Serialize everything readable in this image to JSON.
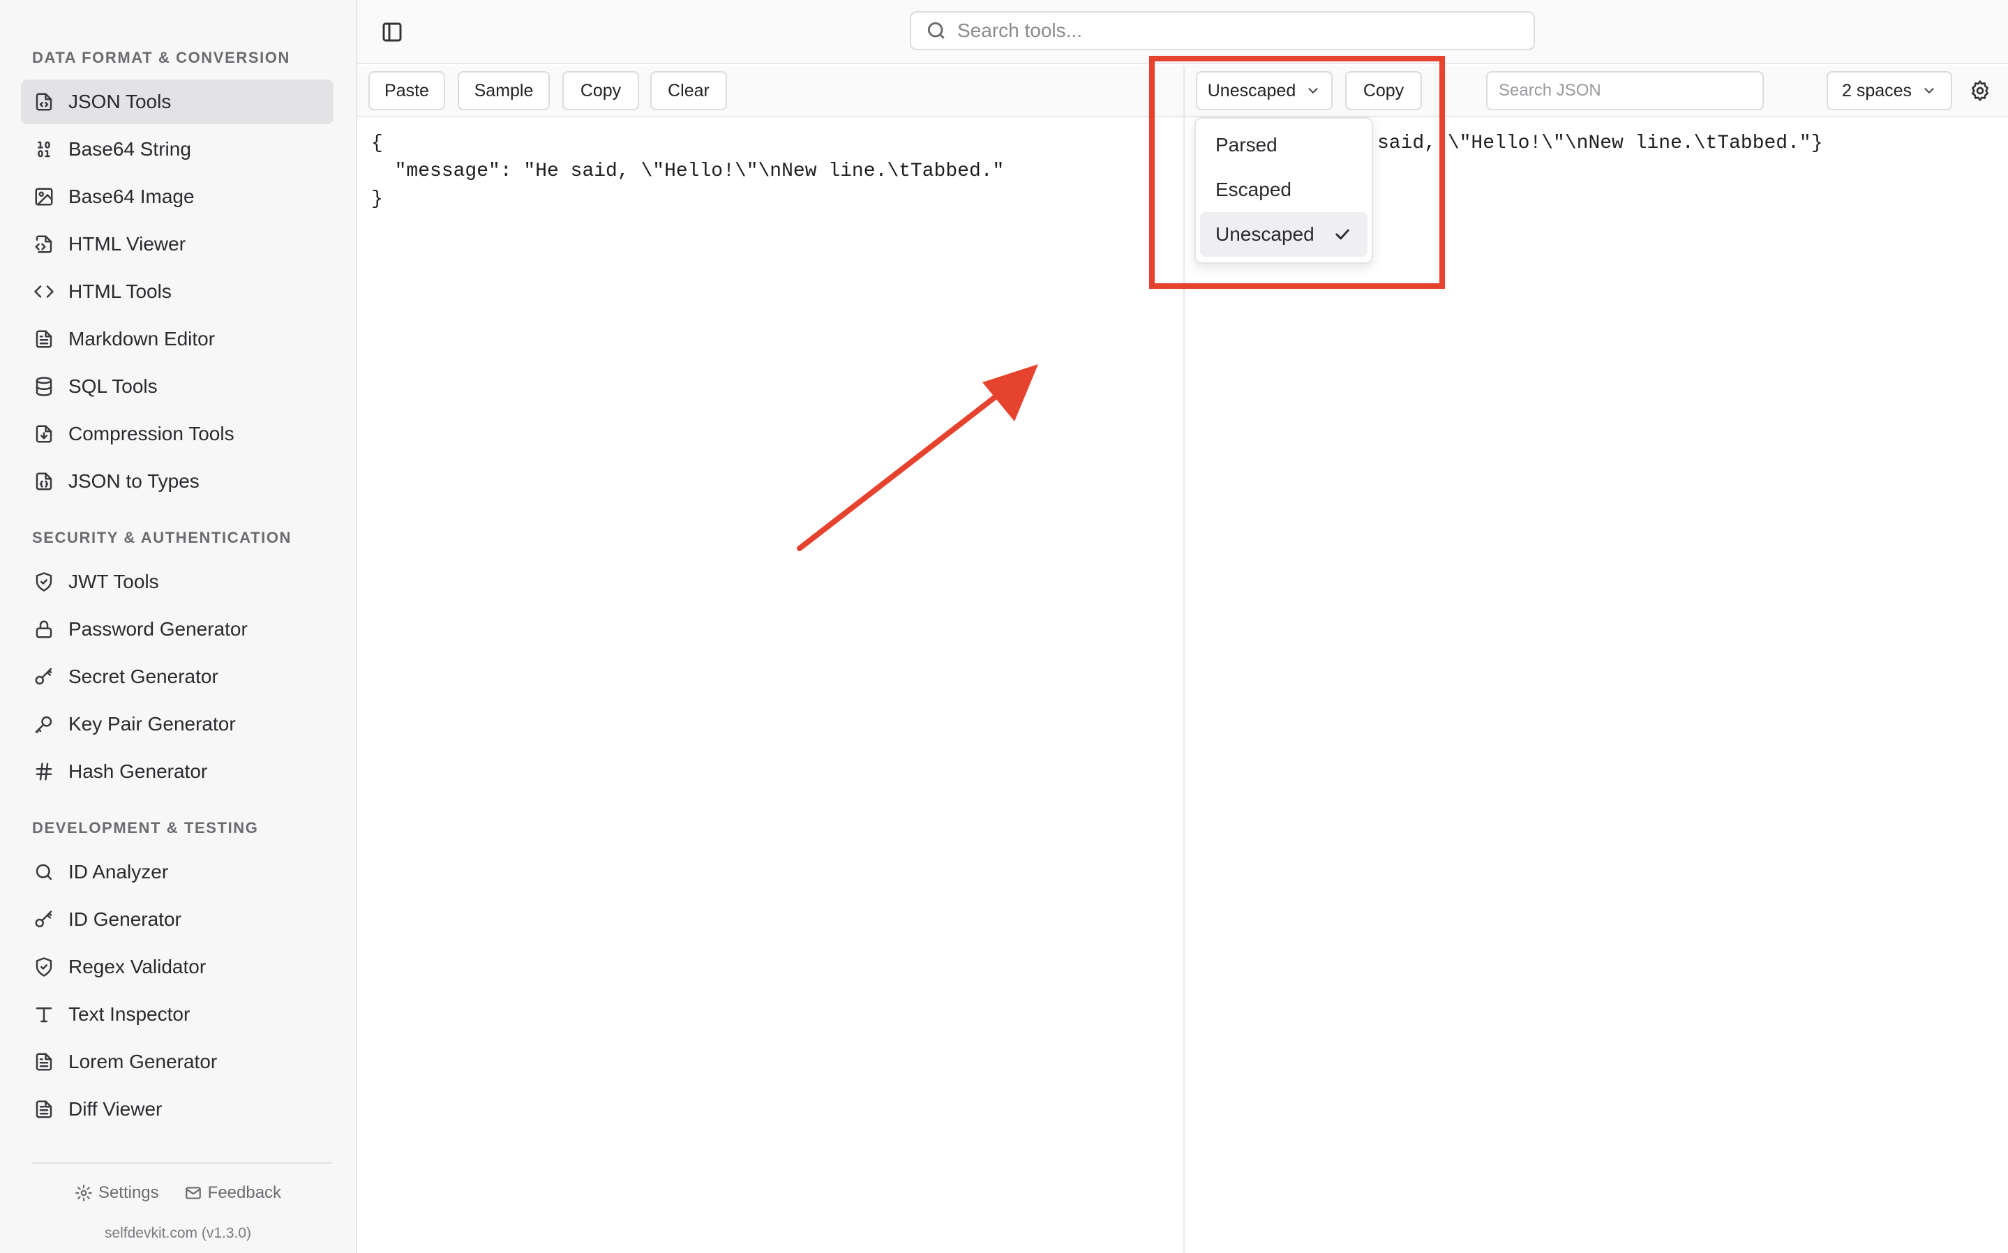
{
  "sidebar": {
    "sections": [
      {
        "title": "DATA FORMAT & CONVERSION",
        "items": [
          {
            "label": "JSON Tools",
            "icon": "file-code-icon",
            "active": true
          },
          {
            "label": "Base64 String",
            "icon": "binary-icon"
          },
          {
            "label": "Base64 Image",
            "icon": "image-icon"
          },
          {
            "label": "HTML Viewer",
            "icon": "file-html-icon"
          },
          {
            "label": "HTML Tools",
            "icon": "code-brackets-icon"
          },
          {
            "label": "Markdown Editor",
            "icon": "file-text-icon"
          },
          {
            "label": "SQL Tools",
            "icon": "database-icon"
          },
          {
            "label": "Compression Tools",
            "icon": "file-archive-icon"
          },
          {
            "label": "JSON to Types",
            "icon": "file-json-icon"
          }
        ]
      },
      {
        "title": "SECURITY & AUTHENTICATION",
        "items": [
          {
            "label": "JWT Tools",
            "icon": "shield-check-icon"
          },
          {
            "label": "Password Generator",
            "icon": "lock-icon"
          },
          {
            "label": "Secret Generator",
            "icon": "key-round-icon"
          },
          {
            "label": "Key Pair Generator",
            "icon": "key-icon"
          },
          {
            "label": "Hash Generator",
            "icon": "hash-icon"
          }
        ]
      },
      {
        "title": "DEVELOPMENT & TESTING",
        "items": [
          {
            "label": "ID Analyzer",
            "icon": "search-icon"
          },
          {
            "label": "ID Generator",
            "icon": "key-round-icon"
          },
          {
            "label": "Regex Validator",
            "icon": "shield-check-icon"
          },
          {
            "label": "Text Inspector",
            "icon": "type-icon"
          },
          {
            "label": "Lorem Generator",
            "icon": "file-text-icon"
          },
          {
            "label": "Diff Viewer",
            "icon": "file-diff-icon"
          }
        ]
      }
    ],
    "footer": {
      "settings_label": "Settings",
      "feedback_label": "Feedback",
      "version": "selfdevkit.com (v1.3.0)"
    }
  },
  "header": {
    "search_placeholder": "Search tools..."
  },
  "input_toolbar": {
    "paste_label": "Paste",
    "sample_label": "Sample",
    "copy_label": "Copy",
    "clear_label": "Clear"
  },
  "output_toolbar": {
    "mode_label": "Unescaped",
    "copy_label": "Copy",
    "search_placeholder": "Search JSON",
    "indent_label": "2 spaces"
  },
  "mode_menu": {
    "options": [
      "Parsed",
      "Escaped",
      "Unescaped"
    ],
    "selected": "Unescaped"
  },
  "input_editor": {
    "text": "{\n  \"message\": \"He said, \\\"Hello!\\\"\\nNew line.\\tTabbed.\"\n}"
  },
  "output_editor": {
    "text": "said, \\\"Hello!\\\"\\nNew line.\\tTabbed.\"}"
  },
  "annotation": {
    "color": "#e5432d"
  }
}
